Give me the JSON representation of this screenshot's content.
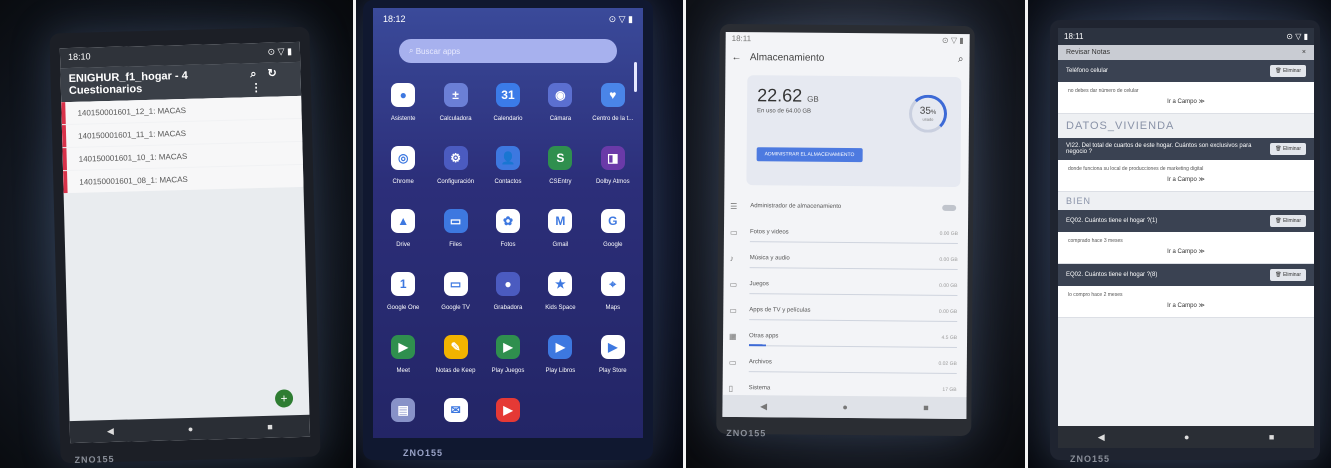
{
  "panel1": {
    "time": "18:10",
    "title": "ENIGHUR_f1_hogar - 4 Cuestionarios",
    "rows": [
      "140150001601_12_1: MACAS",
      "140150001601_11_1: MACAS",
      "140150001601_10_1: MACAS",
      "140150001601_08_1: MACAS"
    ],
    "brand": "ZNO155"
  },
  "panel2": {
    "time": "18:12",
    "search_placeholder": "Buscar apps",
    "apps": [
      {
        "label": "Asistente",
        "icon": "assistant-icon",
        "color": "#ffffff",
        "glyph": "●"
      },
      {
        "label": "Calculadora",
        "icon": "calculator-icon",
        "color": "#6b7fd6",
        "glyph": "±"
      },
      {
        "label": "Calendario",
        "icon": "calendar-icon",
        "color": "#3b7be8",
        "glyph": "31"
      },
      {
        "label": "Cámara",
        "icon": "camera-icon",
        "color": "#5b6fd0",
        "glyph": "◉"
      },
      {
        "label": "Centro de la t...",
        "icon": "heart-shield-icon",
        "color": "#4a85e8",
        "glyph": "♥"
      },
      {
        "label": "Chrome",
        "icon": "chrome-icon",
        "color": "#ffffff",
        "glyph": "◎"
      },
      {
        "label": "Configuración",
        "icon": "settings-icon",
        "color": "#4b5bc0",
        "glyph": "⚙"
      },
      {
        "label": "Contactos",
        "icon": "contacts-icon",
        "color": "#3d78e0",
        "glyph": "👤"
      },
      {
        "label": "CSEntry",
        "icon": "csentry-icon",
        "color": "#2f8f4e",
        "glyph": "S"
      },
      {
        "label": "Dolby Atmos",
        "icon": "dolby-icon",
        "color": "#6a3aa8",
        "glyph": "◨"
      },
      {
        "label": "Drive",
        "icon": "drive-icon",
        "color": "#ffffff",
        "glyph": "▲"
      },
      {
        "label": "Files",
        "icon": "files-icon",
        "color": "#3d78e0",
        "glyph": "▭"
      },
      {
        "label": "Fotos",
        "icon": "photos-icon",
        "color": "#ffffff",
        "glyph": "✿"
      },
      {
        "label": "Gmail",
        "icon": "gmail-icon",
        "color": "#ffffff",
        "glyph": "M"
      },
      {
        "label": "Google",
        "icon": "google-icon",
        "color": "#ffffff",
        "glyph": "G"
      },
      {
        "label": "Google One",
        "icon": "google-one-icon",
        "color": "#ffffff",
        "glyph": "1"
      },
      {
        "label": "Google TV",
        "icon": "google-tv-icon",
        "color": "#ffffff",
        "glyph": "▭"
      },
      {
        "label": "Grabadora",
        "icon": "recorder-icon",
        "color": "#4b5bc0",
        "glyph": "●"
      },
      {
        "label": "Kids Space",
        "icon": "kids-space-icon",
        "color": "#ffffff",
        "glyph": "★"
      },
      {
        "label": "Maps",
        "icon": "maps-icon",
        "color": "#ffffff",
        "glyph": "⌖"
      },
      {
        "label": "Meet",
        "icon": "meet-icon",
        "color": "#2f8f4e",
        "glyph": "▶"
      },
      {
        "label": "Notas de Keep",
        "icon": "keep-icon",
        "color": "#f2b300",
        "glyph": "✎"
      },
      {
        "label": "Play Juegos",
        "icon": "play-games-icon",
        "color": "#2f8f4e",
        "glyph": "▶"
      },
      {
        "label": "Play Libros",
        "icon": "play-books-icon",
        "color": "#3d78e0",
        "glyph": "▶"
      },
      {
        "label": "Play Store",
        "icon": "play-store-icon",
        "color": "#ffffff",
        "glyph": "▶"
      },
      {
        "label": "",
        "icon": "app-icon",
        "color": "#8892c8",
        "glyph": "▤"
      },
      {
        "label": "",
        "icon": "mail-icon",
        "color": "#ffffff",
        "glyph": "✉"
      },
      {
        "label": "",
        "icon": "youtube-icon",
        "color": "#e53935",
        "glyph": "▶"
      }
    ],
    "brand": "ZNO155"
  },
  "panel3": {
    "time": "18:11",
    "title": "Almacenamiento",
    "used_value": "22.62",
    "used_unit": "GB",
    "used_sub": "En uso de 64.00 GB",
    "percent": "35",
    "percent_unit": "%",
    "percent_label": "usado",
    "manage_button": "ADMINISTRAR EL ALMACENAMIENTO",
    "items": [
      {
        "label": "Administrador de almacenamiento",
        "icon": "storage-manager-icon",
        "glyph": "☰",
        "value": "",
        "fill": 0,
        "toggle": true
      },
      {
        "label": "Fotos y videos",
        "icon": "photos-videos-icon",
        "glyph": "▭",
        "value": "0.00 GB",
        "fill": 0
      },
      {
        "label": "Música y audio",
        "icon": "music-icon",
        "glyph": "♪",
        "value": "0.00 GB",
        "fill": 0
      },
      {
        "label": "Juegos",
        "icon": "games-icon",
        "glyph": "▭",
        "value": "0.00 GB",
        "fill": 0
      },
      {
        "label": "Apps de TV y películas",
        "icon": "tv-movies-icon",
        "glyph": "▭",
        "value": "0.00 GB",
        "fill": 0
      },
      {
        "label": "Otras apps",
        "icon": "other-apps-icon",
        "glyph": "▦",
        "value": "4.5 GB",
        "fill": 0.08
      },
      {
        "label": "Archivos",
        "icon": "files-folder-icon",
        "glyph": "▭",
        "value": "0.02 GB",
        "fill": 0
      },
      {
        "label": "Sistema",
        "icon": "system-icon",
        "glyph": "▯",
        "value": "17 GB",
        "fill": 0.27
      }
    ],
    "brand": "ZNO155"
  },
  "panel4": {
    "time": "18:11",
    "title": "Revisar Notas",
    "close": "×",
    "delete_label": "🗑 Eliminar",
    "goto_label": "Ir a Campo ≫",
    "items": [
      {
        "section": "",
        "question": "Teléfono celular",
        "answer": "no debes dar número de celular"
      },
      {
        "section": "DATOS_VIVIENDA",
        "question": "VI22. Del total de cuartos de este hogar. Cuántos son exclusivos para negocio ?",
        "answer": "donde funciona su local de producciones de marketing digital"
      },
      {
        "section": "BIEN",
        "question": "EQ02. Cuántos tiene el hogar ?(1)",
        "answer": "comprado hace 3 meses"
      },
      {
        "section": "",
        "question": "EQ02. Cuántos tiene el hogar ?(8)",
        "answer": "lo compro hace 2 meses"
      }
    ],
    "brand": "ZNO155"
  }
}
